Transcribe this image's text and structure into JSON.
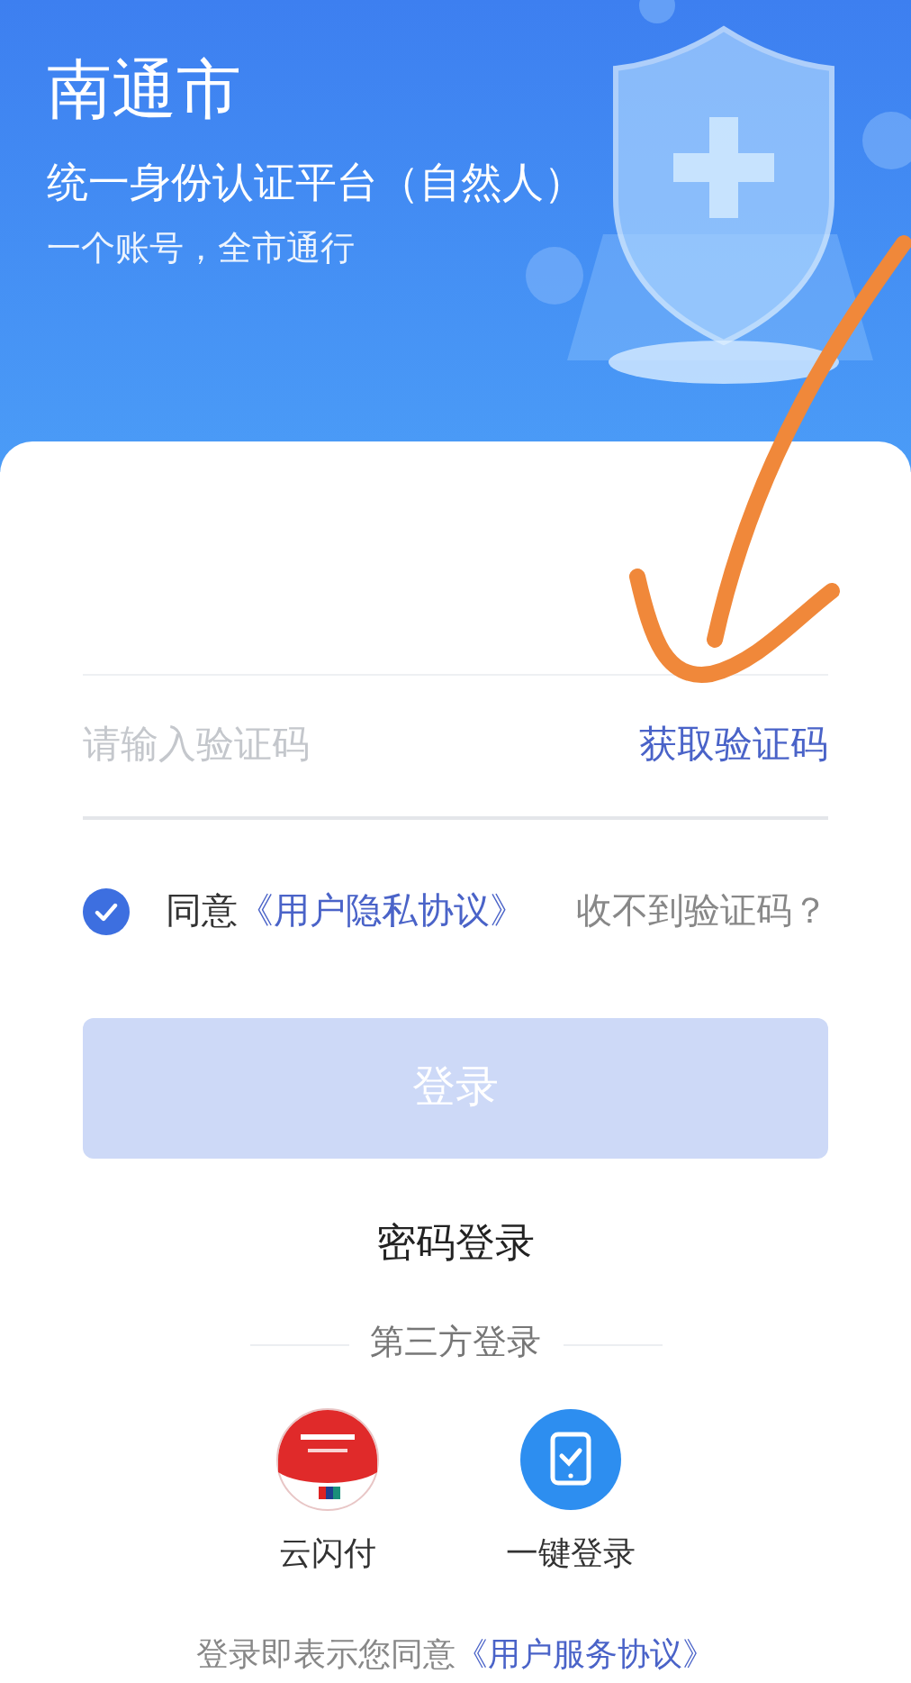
{
  "header": {
    "city": "南通市",
    "title": "统一身份认证平台（自然人）",
    "tagline": "一个账号，全市通行"
  },
  "code_field": {
    "placeholder": "请输入验证码",
    "action": "获取验证码"
  },
  "agreement": {
    "checked": true,
    "prefix": "同意",
    "link": "《用户隐私协议》",
    "help": "收不到验证码？"
  },
  "login_button": {
    "label": "登录",
    "disabled": true
  },
  "password_login": "密码登录",
  "third_party": {
    "title": "第三方登录",
    "options": [
      {
        "kind": "unionpay",
        "label": "云闪付"
      },
      {
        "kind": "tablet",
        "label": "一键登录"
      }
    ]
  },
  "footer": {
    "prefix": "登录即表示您同意",
    "link": "《用户服务协议》"
  }
}
